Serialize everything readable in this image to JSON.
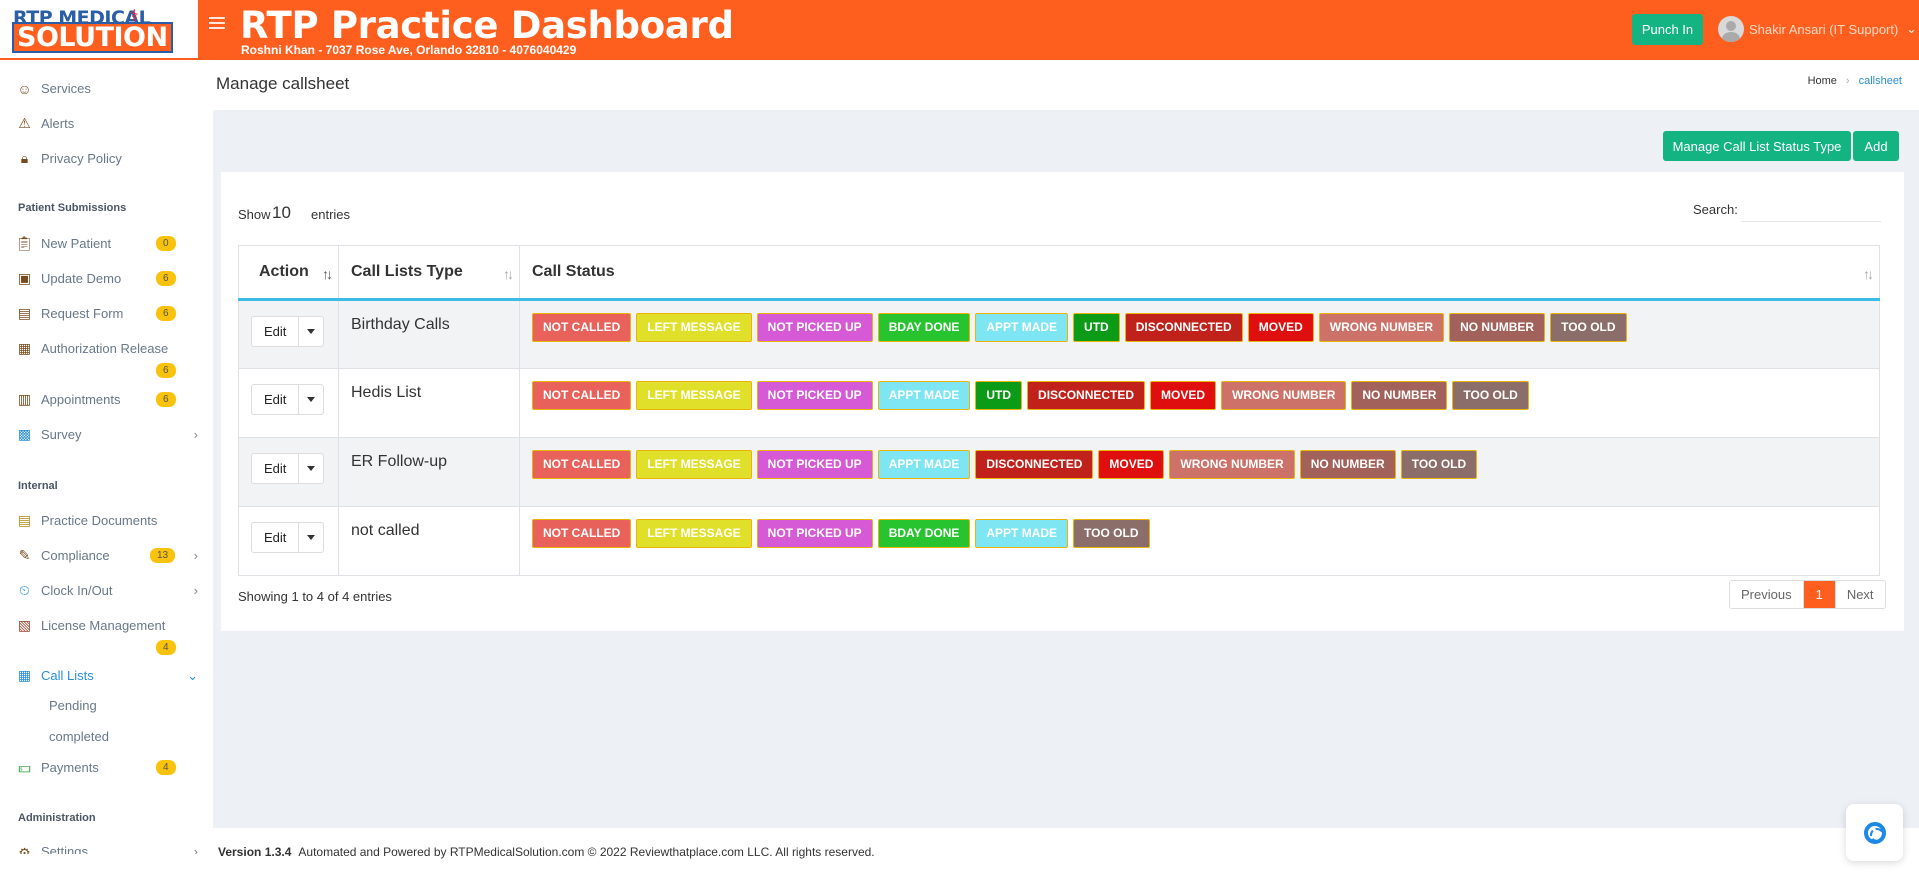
{
  "header": {
    "logo_line1": "RTP MEDICAL",
    "logo_line2": "SOLUTION",
    "title": "RTP Practice Dashboard",
    "subtitle": "Roshni Khan - 7037 Rose Ave, Orlando 32810 - 4076040429",
    "punch_label": "Punch In",
    "user_name": "Shakir Ansari (IT Support)"
  },
  "sidebar": {
    "items_top": [
      {
        "label": "Services",
        "icon": "services-icon"
      },
      {
        "label": "Alerts",
        "icon": "alerts-icon"
      },
      {
        "label": "Privacy Policy",
        "icon": "privacy-icon"
      }
    ],
    "section_patient": "Patient Submissions",
    "patient_items": [
      {
        "label": "New Patient",
        "badge": "0"
      },
      {
        "label": "Update Demo",
        "badge": "6"
      },
      {
        "label": "Request Form",
        "badge": "6"
      },
      {
        "label": "Authorization Release",
        "badge": "6"
      },
      {
        "label": "Appointments",
        "badge": "6"
      },
      {
        "label": "Survey",
        "badge": ""
      }
    ],
    "section_internal": "Internal",
    "internal_items": [
      {
        "label": "Practice Documents",
        "badge": ""
      },
      {
        "label": "Compliance",
        "badge": "13"
      },
      {
        "label": "Clock In/Out",
        "badge": ""
      },
      {
        "label": "License Management",
        "badge": "4"
      },
      {
        "label": "Call Lists",
        "badge": ""
      },
      {
        "label": "Payments",
        "badge": "4"
      }
    ],
    "call_list_sub": [
      "Pending",
      "completed"
    ],
    "section_admin": "Administration",
    "admin_items": [
      {
        "label": "Settings"
      }
    ]
  },
  "page": {
    "title": "Manage callsheet",
    "breadcrumb_home": "Home",
    "breadcrumb_current": "callsheet",
    "btn_manage": "Manage Call List Status Type",
    "btn_add": "Add"
  },
  "table": {
    "length_label": "Show",
    "length_value": "10",
    "length_suffix": "entries",
    "search_label": "Search:",
    "columns": [
      "Action",
      "Call Lists Type",
      "Call Status"
    ],
    "edit_label": "Edit",
    "rows": [
      {
        "type": "Birthday Calls",
        "statuses": [
          "NOT CALLED",
          "LEFT MESSAGE",
          "NOT PICKED UP",
          "BDAY DONE",
          "APPT MADE",
          "UTD",
          "DISCONNECTED",
          "MOVED",
          "WRONG NUMBER",
          "NO NUMBER",
          "TOO OLD"
        ]
      },
      {
        "type": "Hedis List",
        "statuses": [
          "NOT CALLED",
          "LEFT MESSAGE",
          "NOT PICKED UP",
          "APPT MADE",
          "UTD",
          "DISCONNECTED",
          "MOVED",
          "WRONG NUMBER",
          "NO NUMBER",
          "TOO OLD"
        ]
      },
      {
        "type": "ER Follow-up",
        "statuses": [
          "NOT CALLED",
          "LEFT MESSAGE",
          "NOT PICKED UP",
          "APPT MADE",
          "DISCONNECTED",
          "MOVED",
          "WRONG NUMBER",
          "NO NUMBER",
          "TOO OLD"
        ]
      },
      {
        "type": "not called",
        "statuses": [
          "NOT CALLED",
          "LEFT MESSAGE",
          "NOT PICKED UP",
          "BDAY DONE",
          "APPT MADE",
          "TOO OLD"
        ]
      }
    ],
    "status_colors": {
      "NOT CALLED": "#e8615b",
      "LEFT MESSAGE": "#e0e02a",
      "NOT PICKED UP": "#d65ad6",
      "BDAY DONE": "#27c42f",
      "APPT MADE": "#7ee6f2",
      "UTD": "#0c9b17",
      "DISCONNECTED": "#c0221b",
      "MOVED": "#df0f0f",
      "WRONG NUMBER": "#cd7268",
      "NO NUMBER": "#a3615c",
      "TOO OLD": "#8b6d69"
    },
    "info": "Showing 1 to 4 of 4 entries",
    "pager_prev": "Previous",
    "pager_current": "1",
    "pager_next": "Next"
  },
  "footer": {
    "version": "Version 1.3.4",
    "text": "Automated and Powered by RTPMedicalSolution.com © 2022 Reviewthatplace.com LLC. All rights reserved."
  }
}
